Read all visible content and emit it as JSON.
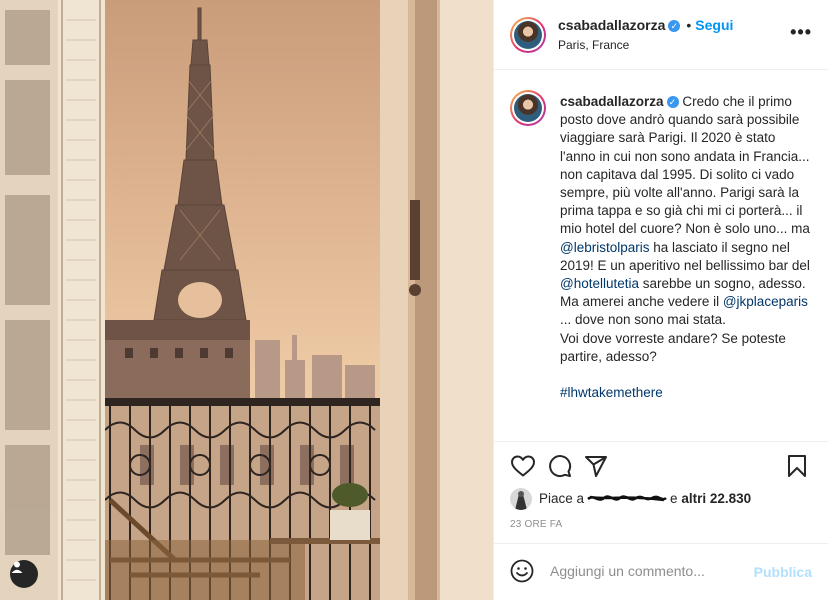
{
  "post": {
    "username": "csabadallazorza",
    "separator": "•",
    "follow_label": "Segui",
    "location": "Paris, France",
    "more_icon": "more-horizontal-icon",
    "caption": {
      "username": "csabadallazorza",
      "text_1": "Credo che il primo posto dove andrò quando sarà possibile viaggiare sarà Parigi. Il 2020 è stato l'anno in cui non sono andata in Francia... non capitava dal 1995. Di solito ci vado sempre, più volte all'anno. Parigi sarà la prima tappa e so già chi mi ci porterà... il mio hotel del cuore? Non è solo uno... ma ",
      "mention_1": "@lebristolparis",
      "text_2": " ha lasciato il segno nel 2019! E un aperitivo nel bellissimo bar del ",
      "mention_2": "@hotellutetia",
      "text_3": " sarebbe un sogno, adesso. Ma amerei anche vedere il ",
      "mention_3": "@jkplaceparis",
      "text_4": " ... dove non sono mai stata.\nVoi dove vorreste andare? Se poteste partire, adesso?\n\n",
      "hashtag": "#lhwtakemethere"
    },
    "likes": {
      "prefix": "Piace a",
      "connector": "e",
      "others": "altri 22.830"
    },
    "timestamp": "23 ORE FA",
    "comment": {
      "placeholder": "Aggiungi un commento...",
      "value": "",
      "publish_label": "Pubblica"
    }
  },
  "colors": {
    "accent": "#0095f6",
    "link": "#00376b",
    "publish_disabled": "#b2dffc",
    "secondary_text": "#8e8e8e"
  }
}
